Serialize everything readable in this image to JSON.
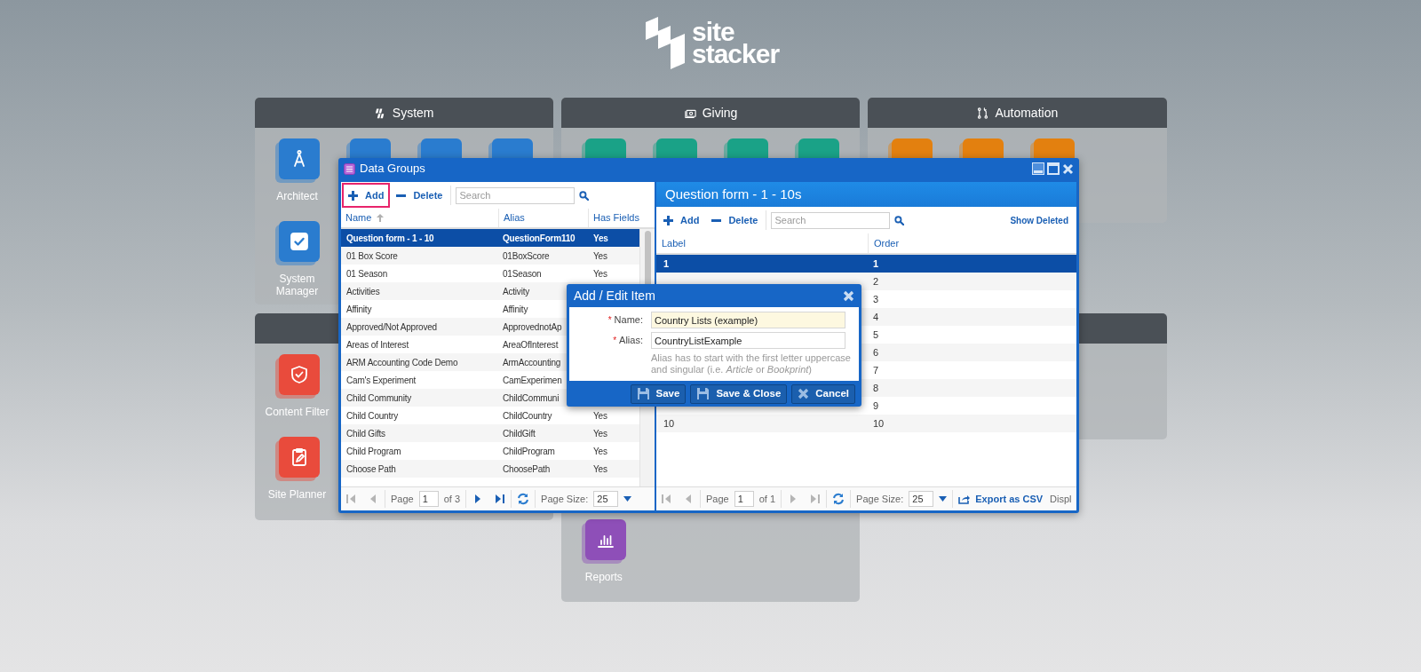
{
  "logo": {
    "wordmark": "site stacker"
  },
  "panels": [
    {
      "kind": "group",
      "title": "System",
      "color": "#2a7ccf",
      "tiles": [
        {
          "kind": "app",
          "label": "Architect"
        },
        {
          "kind": "app"
        },
        {
          "kind": "app"
        },
        {
          "kind": "app"
        },
        {
          "kind": "app",
          "label": "System Manager"
        }
      ]
    },
    {
      "kind": "group",
      "title": "Giving",
      "color": "#1aa287",
      "tiles": [
        {
          "kind": "app"
        },
        {
          "kind": "app"
        },
        {
          "kind": "app"
        },
        {
          "kind": "app"
        }
      ]
    },
    {
      "kind": "group",
      "title": "Automation",
      "color": "#e3800f",
      "tiles": [
        {
          "kind": "app"
        },
        {
          "kind": "app"
        },
        {
          "kind": "app"
        }
      ]
    },
    {
      "kind": "group",
      "color": "#e94b3c",
      "tiles": [
        {
          "kind": "app",
          "label": "Content Filter"
        },
        {
          "kind": "app",
          "label": "Site Planner"
        }
      ]
    },
    {
      "kind": "group",
      "color": "#8e4fb8",
      "tiles": [
        {
          "kind": "app",
          "label": "Reports"
        }
      ]
    },
    {
      "kind": "group"
    }
  ],
  "data_groups": {
    "title": "Data Groups",
    "toolbar": {
      "add": "Add",
      "add_highlighted": true,
      "delete": "Delete",
      "search": {
        "placeholder": "Search"
      }
    },
    "columns": [
      "Name",
      "Alias",
      "Has Fields"
    ],
    "rows": [
      {
        "name": "Question form - 1 - 10",
        "alias": "QuestionForm110",
        "has_fields": "Yes",
        "selected": true
      },
      {
        "name": "01 Box Score",
        "alias": "01BoxScore",
        "has_fields": "Yes",
        "selected": false
      },
      {
        "name": "01 Season",
        "alias": "01Season",
        "has_fields": "Yes",
        "selected": false
      },
      {
        "name": "Activities",
        "alias": "Activity",
        "selected": false
      },
      {
        "name": "Affinity",
        "alias": "Affinity",
        "selected": false
      },
      {
        "name": "Approved/Not Approved",
        "alias": "ApprovednotAp",
        "selected": false
      },
      {
        "name": "Areas of Interest",
        "alias": "AreaOfInterest",
        "selected": false
      },
      {
        "name": "ARM Accounting Code Demo",
        "alias": "ArmAccounting",
        "selected": false
      },
      {
        "name": "Cam's Experiment",
        "alias": "CamExperimen",
        "selected": false
      },
      {
        "name": "Child Community",
        "alias": "ChildCommuni",
        "selected": false
      },
      {
        "name": "Child Country",
        "alias": "ChildCountry",
        "has_fields": "Yes",
        "selected": false
      },
      {
        "name": "Child Gifts",
        "alias": "ChildGift",
        "has_fields": "Yes",
        "selected": false
      },
      {
        "name": "Child Program",
        "alias": "ChildProgram",
        "has_fields": "Yes",
        "selected": false
      },
      {
        "name": "Choose Path",
        "alias": "ChoosePath",
        "has_fields": "Yes",
        "selected": false
      }
    ],
    "pager": {
      "back_enabled": false,
      "forward_enabled": true,
      "page_label": "Page",
      "page": "1",
      "of": "of 3",
      "size_label": "Page Size:",
      "size": "25"
    }
  },
  "fields": {
    "title": "Question form - 1 - 10s",
    "toolbar": {
      "add": "Add",
      "delete": "Delete",
      "search": {
        "placeholder": "Search"
      },
      "show_deleted": "Show Deleted"
    },
    "columns": [
      "Label",
      "Order"
    ],
    "rows": [
      {
        "label": "1",
        "order": "1",
        "selected": true
      },
      {
        "order": "2",
        "selected": false
      },
      {
        "order": "3",
        "selected": false
      },
      {
        "order": "4",
        "selected": false
      },
      {
        "order": "5",
        "selected": false
      },
      {
        "order": "6",
        "selected": false
      },
      {
        "order": "7",
        "selected": false
      },
      {
        "order": "8",
        "selected": false
      },
      {
        "order": "9",
        "selected": false
      },
      {
        "label": "10",
        "order": "10",
        "selected": false
      }
    ],
    "pager": {
      "back_enabled": false,
      "forward_enabled": false,
      "page_label": "Page",
      "page": "1",
      "of": "of 1",
      "size_label": "Page Size:",
      "size": "25",
      "export": "Export as CSV",
      "display": "Displ"
    }
  },
  "modal": {
    "title": "Add / Edit Item",
    "fields": [
      {
        "label": "Name:",
        "value": "Country Lists (example)",
        "required_mark": "*",
        "focused": true
      },
      {
        "label": "Alias:",
        "value": "CountryListExample",
        "required_mark": "*",
        "focused": false
      }
    ],
    "hint": "Alias has to start with the first letter uppercase and singular (i.e. *Article* or *Bookprint*)",
    "buttons": [
      {
        "label": "Save",
        "kind": "save"
      },
      {
        "label": "Save & Close",
        "kind": "save"
      },
      {
        "label": "Cancel",
        "kind": "cancel"
      }
    ]
  }
}
